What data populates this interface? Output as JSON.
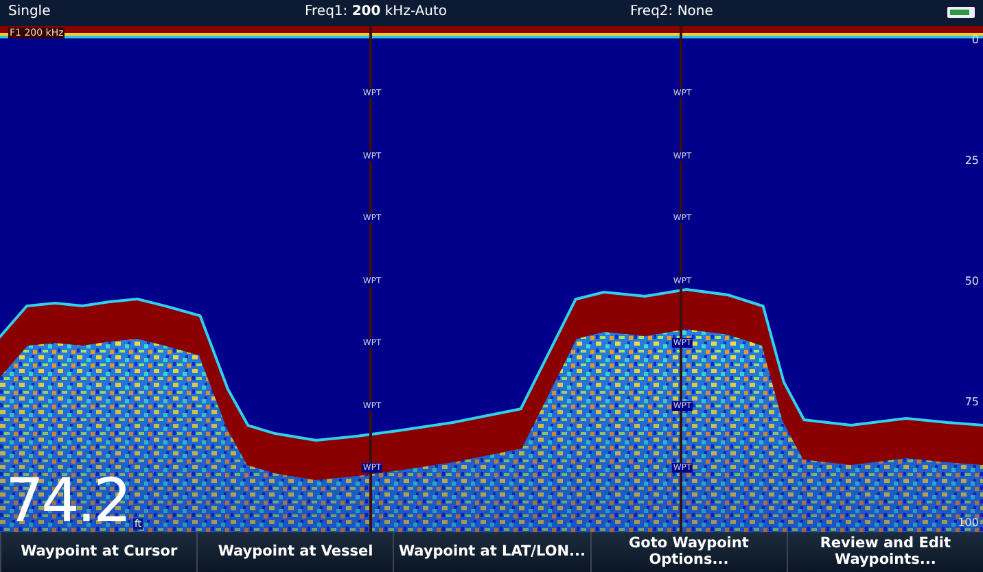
{
  "top_bar": {
    "mode": "Single",
    "freq1": "Freq1: **200** kHz-Auto",
    "freq2": "Freq2: None"
  },
  "sonar": {
    "channel_label": "F1 200 kHz",
    "waypoint_markers": [
      {
        "labels": [
          "WPT",
          "WPT",
          "WPT",
          "WPT",
          "WPT",
          "WPT",
          "WPT"
        ]
      },
      {
        "labels": [
          "WPT",
          "WPT",
          "WPT",
          "WPT",
          "WPT",
          "WPT",
          "WPT"
        ]
      }
    ],
    "depth_scale": [
      "0",
      "25",
      "50",
      "75",
      "100"
    ],
    "depth": {
      "value": "74.2",
      "unit": "ft"
    }
  },
  "buttons": [
    "Waypoint at Cursor",
    "Waypoint at Vessel",
    "Waypoint at LAT/LON...",
    "Goto Waypoint Options...",
    "Review and Edit Waypoints..."
  ]
}
